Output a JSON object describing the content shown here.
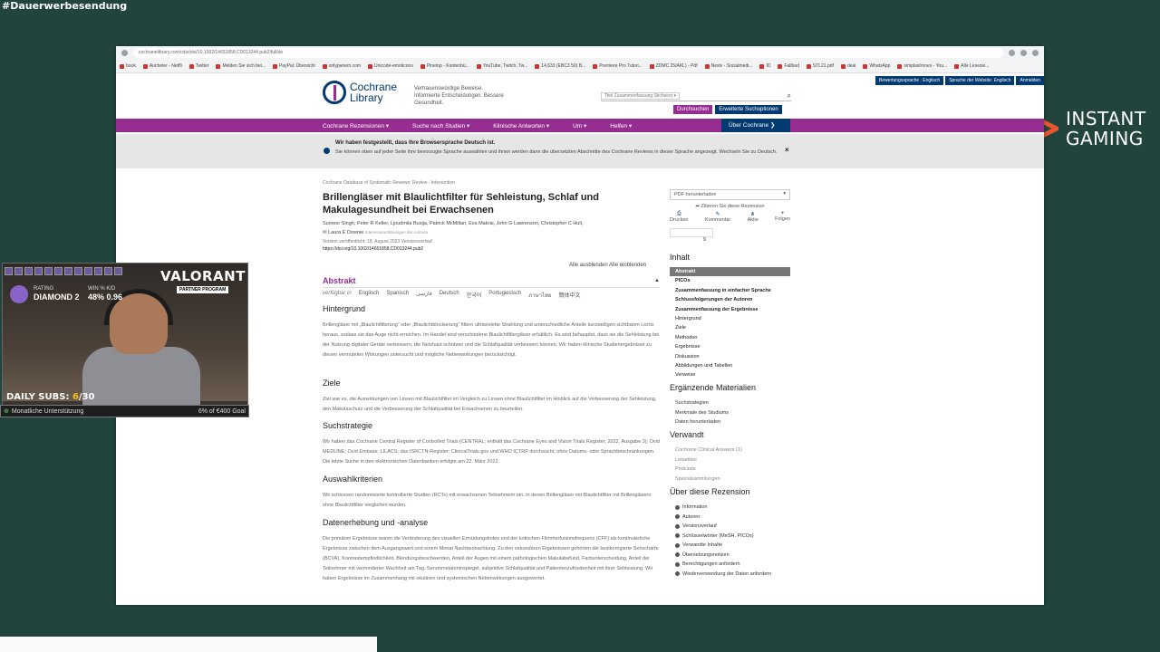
{
  "overlay": {
    "hashtag": "#Dauerwerbesendung",
    "instant_gaming_line1": "INSTANT",
    "instant_gaming_line2": "GAMING"
  },
  "browser": {
    "url": "cochranelibrary.com/cdsr/doi/10.1002/14651858.CD013244.pub2/full/de",
    "bookmarks": [
      "book",
      "Aucheter - Netfli",
      "Twitter",
      "Melden Sie sich bei...",
      "PayPal: Übersicht",
      "onlypanem.com",
      "Unicode-emoticons",
      "Pinetop - Kontenbü...",
      "YouTube, Twitch, Tw...",
      "14,633 (EBC3 50) B...",
      "Premiere Pro Tutori...",
      "ZDMC 25/AKL) - Pdf",
      "Nextv - Socialmedi...",
      "ID",
      "Fallbad",
      "STL21.pdf",
      "deal",
      "WhatsApp",
      "simplastrones - You...",
      "Alle Lesezei..."
    ]
  },
  "site": {
    "utility": [
      "Bewertungssprache : Englisch",
      "Sprache der Website: Englisch",
      "Anmelden"
    ],
    "logo_line1": "Cochrane",
    "logo_line2": "Library",
    "tagline": "Vertrauenswürdige Beweise. Informierte Entscheidungen. Bessere Gesundheit.",
    "search_select": "Titel Zusammenfassung Stichwort ▾",
    "search_button": "Durchsuchen",
    "advanced_button": "Erweiterte Suchoptionen",
    "nav": [
      "Cochrane Rezensionen ▾",
      "Suche nach Studien ▾",
      "Klinische Antworten ▾",
      "Um ▾",
      "Helfen ▾"
    ],
    "nav_about": "Über Cochrane ❯",
    "banner_title": "Wir haben festgestellt, dass Ihre Browsersprache Deutsch ist.",
    "banner_text": "Sie können oben auf jeder Seite ihre bevorzugte Sprache auswählen und ihnen werden dann die übersetzten Abschnitte des Cochrane Reviews in dieser Sprache angezeigt. Wechseln Sie zu Deutsch.",
    "banner_close": "×"
  },
  "article": {
    "crumb": "Cochrane Database of Systematic Reviews: Review - Intervention",
    "title": "Brillengläser mit Blaulichtfilter für Sehleistung, Schlaf und Makulagesundheit bei Erwachsenen",
    "authors": "Sumeer Singh, Peter R Keller, Ljoudmila Busija, Patrick McMillan, Eva Makrai, John G Lawrenson, Christopher C Hull,",
    "authors2": "✉ Laura E Downie",
    "conflicts": "Interessenerklärungen der Autoren",
    "version": "Version veröffentlicht: 18. August 2023   Versionsverlauf",
    "doi": "https://doi.org/10.1002/14651858.CD013244.pub2",
    "alle": "Alle   ausblenden Alle einblenden",
    "abstract": "Abstrakt",
    "available_in": "verfügbar in",
    "languages": [
      "Englisch",
      "Spanisch",
      "فارسی",
      "Deutsch",
      "한국어",
      "Portugiesisch",
      "ภาษาไทย",
      "簡体中文"
    ],
    "sections": [
      {
        "h": "Hintergrund",
        "p": "Brillengläser mit „Blaulichtfilterung“ oder „Blaulichtblockierung“ filtern ultraviolette Strahlung und unterschiedliche Anteile kurzwelligen sichtbaren Lichts heraus, sodass sie das Auge nicht erreichen. Im Handel sind verschiedene Blaulichtfiltergläser erhältlich. Es wird behauptet, dass sie die Sehleistung bei der Nutzung digitaler Geräte verbessern, die Netzhaut schützen und die Schlafqualität verbessern können. Wir haben klinische Studienergebnisse zu diesen vermuteten Wirkungen untersucht und mögliche Nebenwirkungen berücksichtigt."
      },
      {
        "h": "Ziele",
        "p": "Ziel war es, die Auswirkungen von Linsen mit Blaulichtfilter im Vergleich zu Linsen ohne Blaulichtfilter im Hinblick auf die Verbesserung der Sehleistung, den Makulaschutz und die Verbesserung der Schlafqualität bei Erwachsenen zu beurteilen."
      },
      {
        "h": "Suchstrategie",
        "p": "Wir haben das Cochrane Central Register of Controlled Trials (CENTRAL; enthält das Cochrane Eyes and Vision Trials Register; 2022, Ausgabe 3); Ovid MEDLINE; Ovid Embase; LILACS; das ISRCTN-Register; ClinicalTrials.gov und WHO ICTRP durchsucht, ohne Datums- oder Sprachbeschränkungen. Die letzte Suche in den elektronischen Datenbanken erfolgte am 22. März 2022."
      },
      {
        "h": "Auswahlkriterien",
        "p": "Wir schlossen randomisierte kontrollierte Studien (RCTs) mit erwachsenen Teilnehmern ein, in denen Brillengläser mit Blaulichtfilter mit Brillengläsern ohne Blaulichtfilter verglichen wurden."
      },
      {
        "h": "Datenerhebung und -analyse",
        "p": "Die primären Ergebnisse waren die Veränderung des visuellen Ermüdungsindex und der kritischen Flimmerfusionsfrequenz (CFF) als kontinuierliche Ergebnisse zwischen dem Ausgangswert und einem Monat Nachbeobachtung. Zu den sekundären Ergebnissen gehörten die bestkorrigierte Sehschärfe (BCVA), Kontrastempfindlichkeit, Blendungsbeschwerden, Anteil der Augen mit einem pathologischen Makulabefund, Farbunterscheidung, Anteil der Teilnehmer mit verminderter Wachheit am Tag, Serummelatoninspiegel, subjektive Schlafqualität und Patientenzufriedenheit mit ihrer Sehleistung. Wir haben Ergebnisse im Zusammenhang mit okulären und systemischen Nebenwirkungen ausgewertet."
      }
    ]
  },
  "sidebar": {
    "pdf": "PDF herunterladen",
    "cite": "➦ Zitieren Sie diese Rezension",
    "actions": [
      {
        "icon": "⎙",
        "label": "Drucken"
      },
      {
        "icon": "✎",
        "label": "Kommentar"
      },
      {
        "icon": "⋔",
        "label": "Aktie"
      },
      {
        "icon": "+",
        "label": "Folgen"
      }
    ],
    "altmetric": "9",
    "inhalt": "Inhalt",
    "toc": [
      "Abstrakt",
      "PICOs",
      "Zusammenfassung in einfacher Sprache",
      "Schlussfolgerungen der Autoren",
      "Zusammenfassung der Ergebnisse",
      "Hintergrund",
      "Ziele",
      "Methoden",
      "Ergebnisse",
      "Diskussion",
      "Abbildungen und Tabellen",
      "Verweise"
    ],
    "ergaenzend": "Ergänzende Materialien",
    "ergaenzend_items": [
      "Suchstrategien",
      "Merkmale des Studiums",
      "Daten herunterladen"
    ],
    "verwandt": "Verwandt",
    "verwandt_items": [
      "Cochrane Clinical Answers (1)",
      "Leitartikel",
      "Podcasts",
      "Spezialsammlungen"
    ],
    "about": "Über diese Rezension",
    "about_items": [
      "Information",
      "Autoren",
      "Versionsverlauf",
      "Schlüsselwörter (MeSH, PICOs)",
      "Verwandte Inhalte",
      "Übersetzungsnotizen",
      "Berechtigungen anfordern",
      "Wiederverwendung der Daten anfordern"
    ]
  },
  "stream": {
    "game_logo": "VALORANT",
    "partner": "PARTNER PROGRAM",
    "rating_label": "RATING",
    "winkd_label": "WIN % K/D",
    "rank": "DIAMOND 2",
    "stats": "48% 0.96",
    "subs_label": "DAILY SUBS: ",
    "subs_current": "6",
    "subs_total": "/30",
    "goal_label": "Monatliche Unterstützung",
    "goal_value": "6% of €400 Goal"
  }
}
